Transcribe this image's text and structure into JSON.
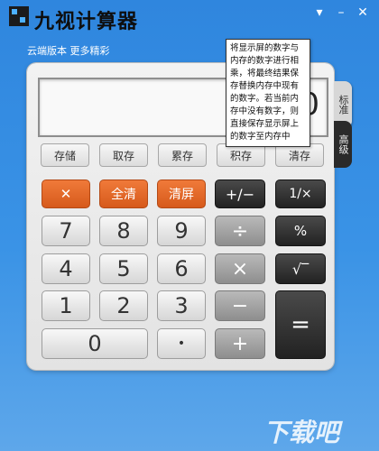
{
  "window": {
    "title": "九视计算器",
    "subtitle": "云端版本 更多精彩"
  },
  "titlebar_controls": {
    "menu": "▾",
    "minimize": "–",
    "close": "✕"
  },
  "display": {
    "value": "0"
  },
  "side_tabs": {
    "standard": "标准",
    "advanced": "高级"
  },
  "memory_buttons": [
    "存储",
    "取存",
    "累存",
    "积存",
    "清存"
  ],
  "keys": {
    "backspace": "✕",
    "clear_all": "全清",
    "clear_screen": "清屏",
    "negate": "+/−",
    "reciprocal": "1/×",
    "num7": "7",
    "num8": "8",
    "num9": "9",
    "divide": "÷",
    "percent": "%",
    "num4": "4",
    "num5": "5",
    "num6": "6",
    "multiply": "×",
    "sqrt": "√‾",
    "num1": "1",
    "num2": "2",
    "num3": "3",
    "minus": "−",
    "equals": "=",
    "num0": "0",
    "dot": "•",
    "plus": "+"
  },
  "tooltip": {
    "lines": [
      "将显示屏的数字与",
      "内存的数字进行相",
      "乘，将最终结果保",
      "存替换内存中现有",
      "的数字。若当前内",
      "存中没有数字，则",
      "直接保存显示屏上",
      "的数字至内存中"
    ]
  },
  "watermark": "下载吧"
}
